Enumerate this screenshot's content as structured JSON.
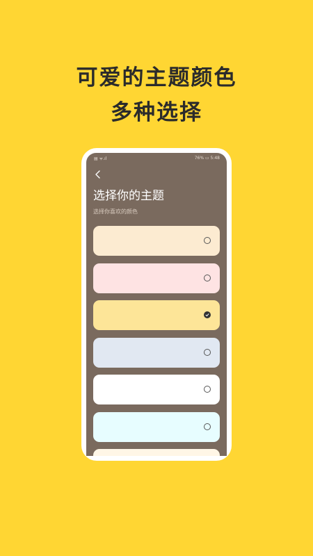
{
  "headline": {
    "line1": "可爱的主题颜色",
    "line2": "多种选择"
  },
  "status_bar": {
    "left": "▤ ᯤ.ıl",
    "right": "76% ▭ 5:48"
  },
  "screen": {
    "title": "选择你的主题",
    "subtitle": "选择你喜欢的颜色"
  },
  "themes": [
    {
      "color": "#FCEBD1",
      "selected": false
    },
    {
      "color": "#FEE3E3",
      "selected": false
    },
    {
      "color": "#FDE598",
      "selected": true
    },
    {
      "color": "#E1E8F2",
      "selected": false
    },
    {
      "color": "#FFFFFF",
      "selected": false
    },
    {
      "color": "#E7FDFF",
      "selected": false
    },
    {
      "color": "#FFF6E6",
      "selected": false
    }
  ],
  "colors": {
    "background": "#FFD633",
    "screen": "#7A6A5E"
  }
}
